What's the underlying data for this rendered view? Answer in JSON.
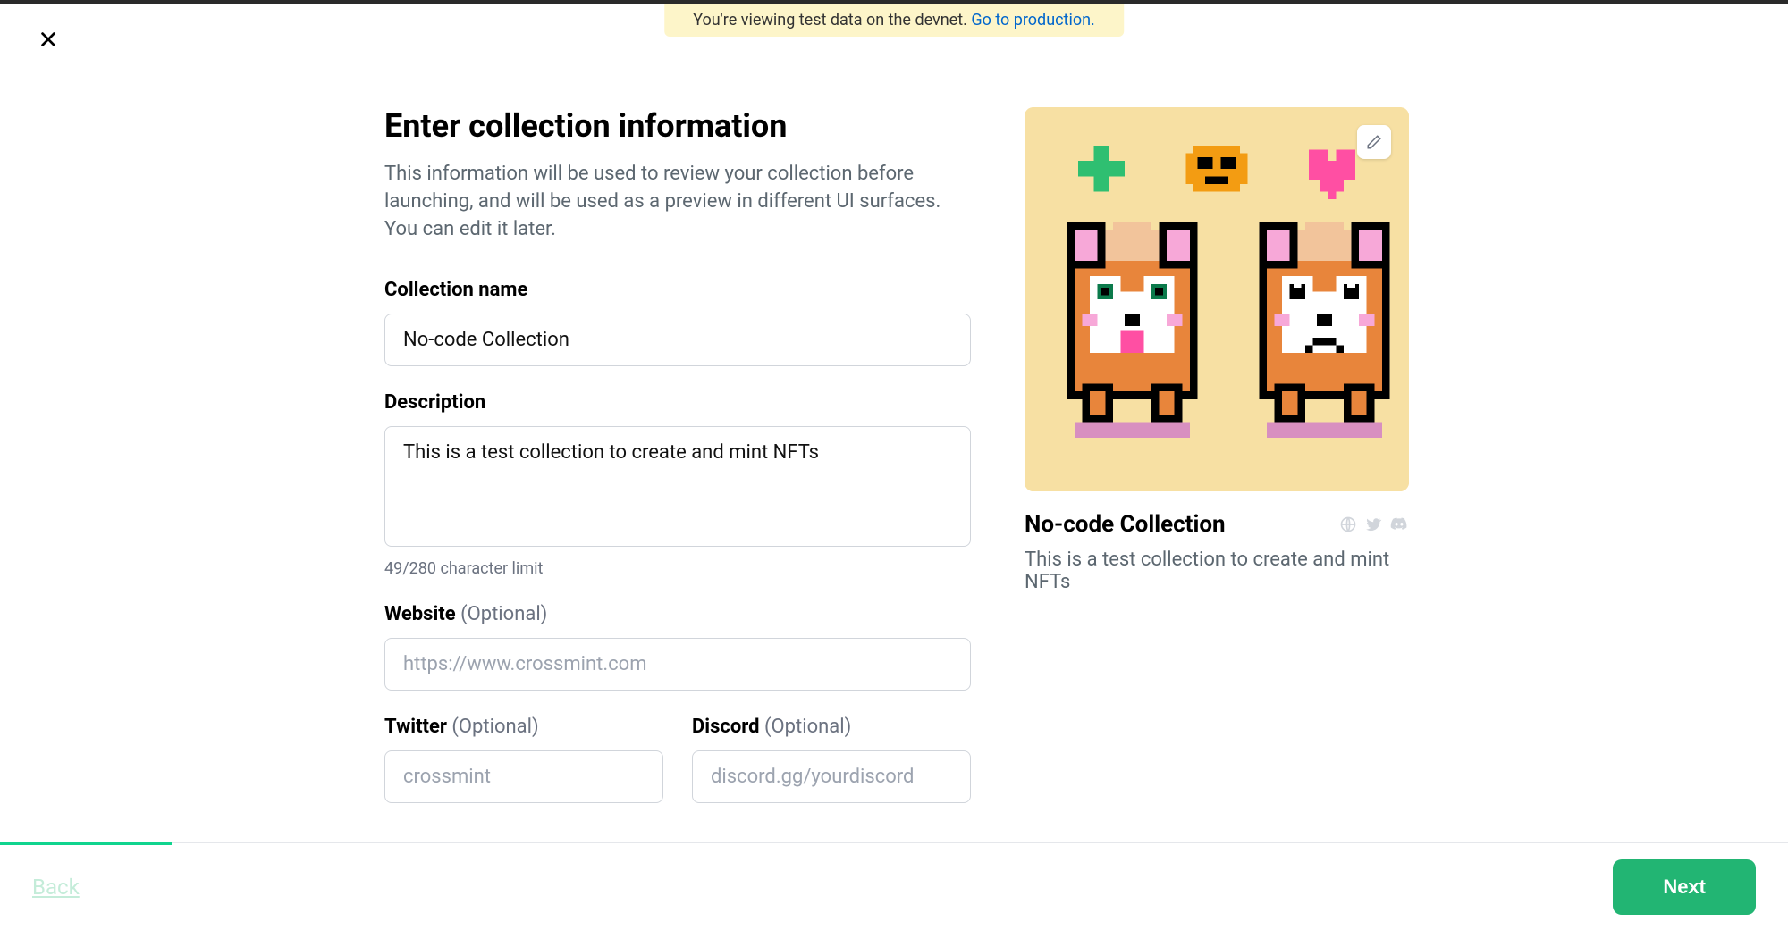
{
  "banner": {
    "text": "You're viewing test data on the devnet. ",
    "link_text": "Go to production."
  },
  "page": {
    "title": "Enter collection information",
    "subtitle": "This information will be used to review your collection before launching, and will be used as a preview in different UI surfaces. You can edit it later."
  },
  "form": {
    "collection_name": {
      "label": "Collection name",
      "value": "No-code Collection"
    },
    "description": {
      "label": "Description",
      "value": "This is a test collection to create and mint NFTs",
      "char_count": "49",
      "char_max": "280",
      "char_limit_text": "49/280 character limit"
    },
    "website": {
      "label": "Website ",
      "optional": "(Optional)",
      "placeholder": "https://www.crossmint.com",
      "value": ""
    },
    "twitter": {
      "label": "Twitter ",
      "optional": "(Optional)",
      "placeholder": "crossmint",
      "value": ""
    },
    "discord": {
      "label": "Discord ",
      "optional": "(Optional)",
      "placeholder": "discord.gg/yourdiscord",
      "value": ""
    }
  },
  "preview": {
    "title": "No-code Collection",
    "description": "This is a test collection to create and mint NFTs"
  },
  "footer": {
    "back": "Back",
    "next": "Next",
    "progress_percent": 9.6
  }
}
